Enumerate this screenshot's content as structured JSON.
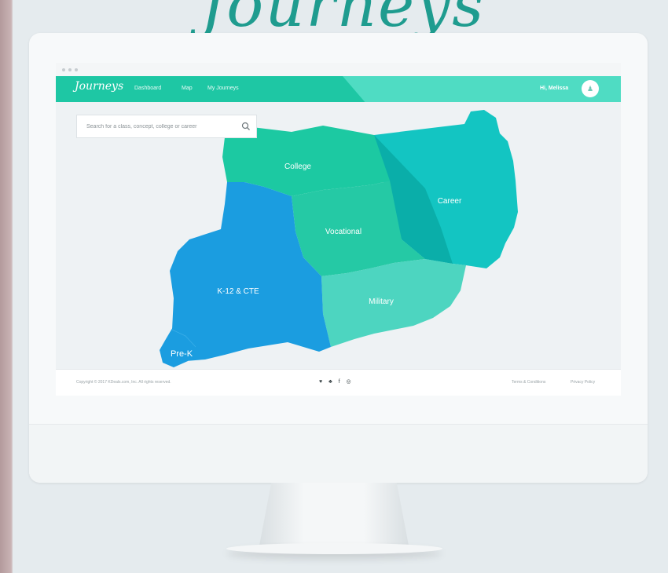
{
  "hero": {
    "title": "Journeys"
  },
  "app": {
    "logo": "Journeys",
    "nav": [
      "Dashboard",
      "Map",
      "My Journeys"
    ],
    "greeting": "Hi, Melissa",
    "avatar_glyph": "♟"
  },
  "search": {
    "placeholder": "Search for a class, concept, college or career",
    "icon": "search-icon"
  },
  "map": {
    "regions": [
      {
        "label": "College",
        "color": "#1cc9a2"
      },
      {
        "label": "Career",
        "color": "#13c5c2"
      },
      {
        "label": "Vocational",
        "color": "#25c9a5"
      },
      {
        "label": "Military",
        "color": "#4dd5c0"
      },
      {
        "label": "K-12 & CTE",
        "color": "#1b9de0"
      },
      {
        "label": "Pre-K",
        "color": "#1b9de0"
      }
    ]
  },
  "footer": {
    "copyright": "Copyright © 2017 KDeals.com, Inc. All rights reserved.",
    "social": "♥ ♣ f ◎",
    "links": [
      "Terms & Conditions",
      "Privacy Policy"
    ]
  },
  "colors": {
    "brand": "#1ec7a4",
    "brand_light": "#4fdcc3",
    "k12": "#1b9de0"
  }
}
